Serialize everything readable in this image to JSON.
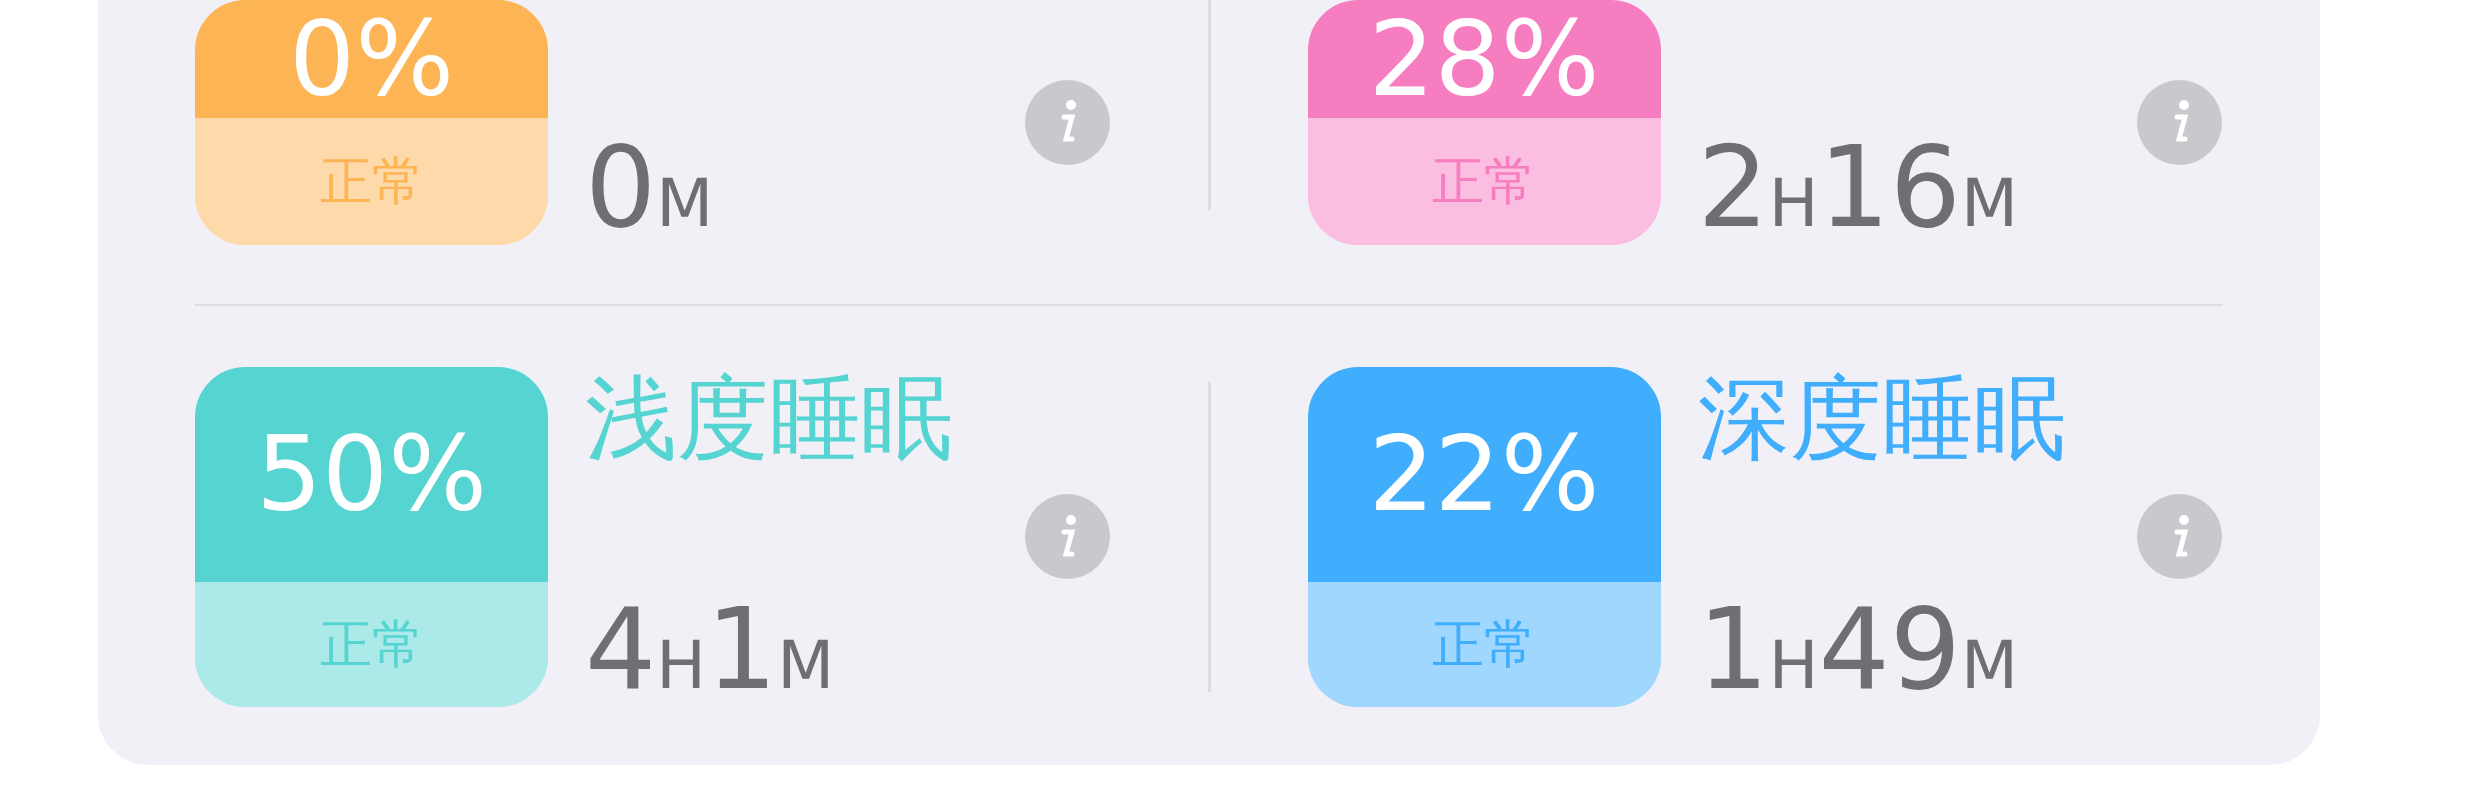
{
  "rows": [
    {
      "cards": [
        {
          "percent": "0%",
          "status": "正常",
          "color": "#fdb454",
          "duration": [
            {
              "value": "0",
              "unit": "M"
            }
          ]
        },
        {
          "percent": "28%",
          "status": "正常",
          "color": "#f77dc1",
          "duration": [
            {
              "value": "2",
              "unit": "H"
            },
            {
              "value": "16",
              "unit": "M"
            }
          ]
        }
      ]
    },
    {
      "cards": [
        {
          "percent": "50%",
          "title": "浅度睡眠",
          "status": "正常",
          "color": "#56d4d2",
          "duration": [
            {
              "value": "4",
              "unit": "H"
            },
            {
              "value": "1",
              "unit": "M"
            }
          ]
        },
        {
          "percent": "22%",
          "title": "深度睡眠",
          "status": "正常",
          "color": "#40aefc",
          "duration": [
            {
              "value": "1",
              "unit": "H"
            },
            {
              "value": "49",
              "unit": "M"
            }
          ]
        }
      ]
    }
  ]
}
